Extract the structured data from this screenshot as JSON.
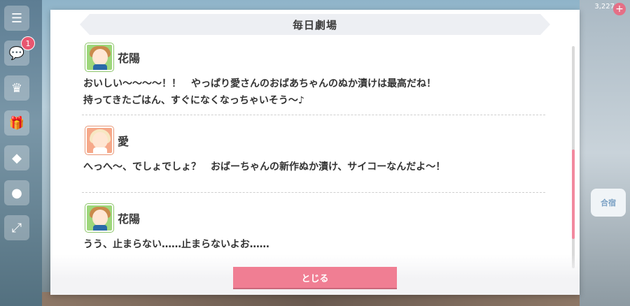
{
  "background": {
    "currency_count": "3,227",
    "right_button_label": "合宿",
    "notification_count": "1"
  },
  "dialog": {
    "title": "毎日劇場",
    "close_label": "とじる",
    "entries": [
      {
        "speaker": "花陽",
        "avatar": "hanayo-avatar",
        "lines": [
          "おいしい〜〜〜〜！！　やっぱり愛さんのおばあちゃんのぬか漬けは最高だね！",
          "持ってきたごはん、すぐになくなっちゃいそう〜♪"
        ]
      },
      {
        "speaker": "愛",
        "avatar": "ai-avatar",
        "lines": [
          "へっへ〜、でしょでしょ？　おばーちゃんの新作ぬか漬け、サイコーなんだよ〜！"
        ]
      },
      {
        "speaker": "花陽",
        "avatar": "hanayo-avatar",
        "lines": [
          "うう、止まらない……止まらないよお……"
        ]
      }
    ]
  },
  "colors": {
    "accent": "#f07e93",
    "scroll_thumb": "#f2899e",
    "title_bar": "#edeff3"
  }
}
